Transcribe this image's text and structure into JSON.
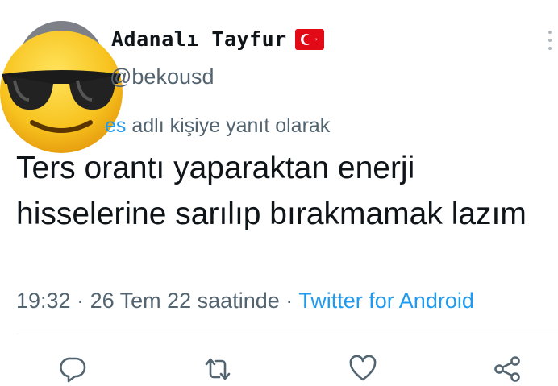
{
  "author": {
    "display_name": "Adanalı Tayfur",
    "handle": "@bekousd",
    "avatar_icon": "sunglasses-face-emoji",
    "flag_icon": "turkey-flag"
  },
  "reply_context": {
    "mention": "es",
    "text": " adlı kişiye yanıt olarak"
  },
  "tweet": {
    "text": "Ters orantı yaparaktan enerji hisselerine sarılıp bırakmamak lazım"
  },
  "meta": {
    "time": "19:32",
    "separator1": " · ",
    "date": "26 Tem 22 saatinde",
    "separator2": " · ",
    "source": "Twitter for Android"
  },
  "actions": [
    {
      "name": "reply",
      "icon": "comment-icon"
    },
    {
      "name": "retweet",
      "icon": "retweet-icon"
    },
    {
      "name": "like",
      "icon": "heart-icon"
    },
    {
      "name": "share",
      "icon": "share-icon"
    }
  ],
  "colors": {
    "accent": "#1d9bf0",
    "text": "#0f1419",
    "secondary": "#536471"
  }
}
